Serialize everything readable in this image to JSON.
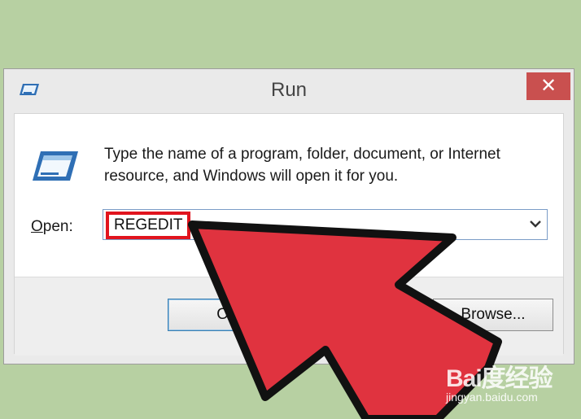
{
  "window": {
    "title": "Run",
    "close_glyph": "✕"
  },
  "dialog": {
    "description": "Type the name of a program, folder, document, or Internet resource, and Windows will open it for you.",
    "open_label_accel": "O",
    "open_label_rest": "pen:",
    "open_value": "REGEDIT",
    "highlight_color": "#e1141e"
  },
  "buttons": {
    "ok": "OK",
    "browse": "Browse..."
  },
  "icons": {
    "app": "run-icon",
    "dropdown": "chevron-down-icon",
    "arrow_overlay": "red-arrow"
  },
  "colors": {
    "background": "#b7d0a2",
    "close": "#c9504f",
    "arrow": "#e0333f"
  },
  "watermark": {
    "logo": "Bai度经验",
    "url": "jingyan.baidu.com"
  }
}
